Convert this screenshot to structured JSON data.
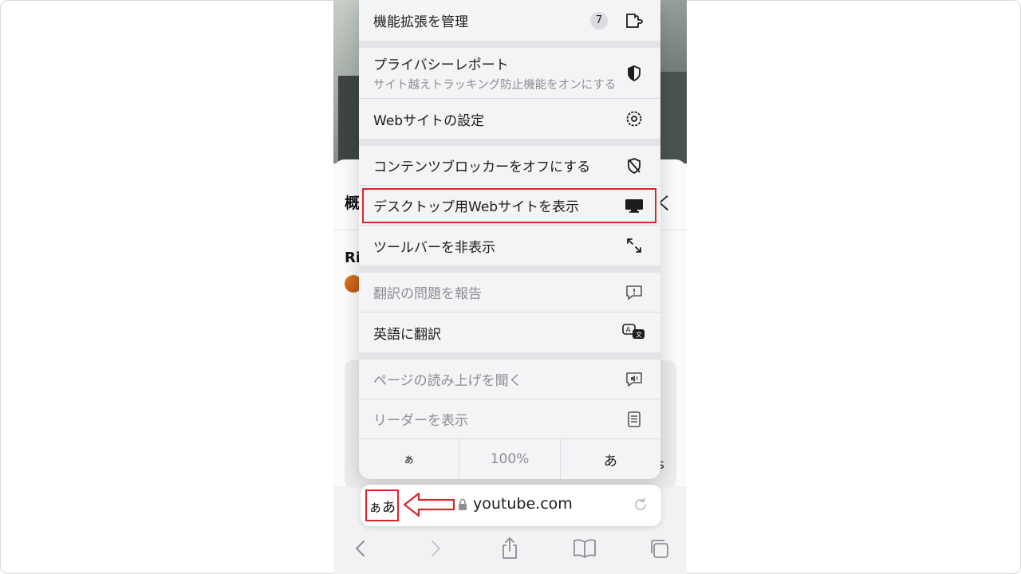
{
  "page": {
    "title_fragment": "概",
    "row_fragment": "Ri",
    "chevron": "く",
    "side_fragment": "s"
  },
  "menu": {
    "extensions": {
      "label": "機能拡張を管理",
      "badge": "7",
      "icon": "extension-icon"
    },
    "privacy": {
      "label": "プライバシーレポート",
      "sub": "サイト越えトラッキング防止機能をオンにする",
      "icon": "shield-icon"
    },
    "website_settings": {
      "label": "Webサイトの設定",
      "icon": "gear-icon"
    },
    "content_blockers": {
      "label": "コンテンツブロッカーをオフにする",
      "icon": "shield-slash-icon"
    },
    "desktop_site": {
      "label": "デスクトップ用Webサイトを表示",
      "icon": "desktop-icon"
    },
    "hide_toolbar": {
      "label": "ツールバーを非表示",
      "icon": "expand-arrows-icon"
    },
    "report_translation": {
      "label": "翻訳の問題を報告",
      "icon": "exclamation-bubble-icon"
    },
    "translate": {
      "label": "英語に翻訳",
      "icon": "translate-icon"
    },
    "listen": {
      "label": "ページの読み上げを聞く",
      "icon": "speaker-bubble-icon"
    },
    "reader": {
      "label": "リーダーを表示",
      "icon": "reader-icon"
    },
    "font_size": {
      "smaller": "ぁ",
      "zoom": "100%",
      "larger": "あ"
    }
  },
  "address_bar": {
    "format_button": "ぁあ",
    "url": "youtube.com"
  },
  "colors": {
    "highlight": "#d9262b",
    "menu_bg": "#f4f4f6"
  }
}
